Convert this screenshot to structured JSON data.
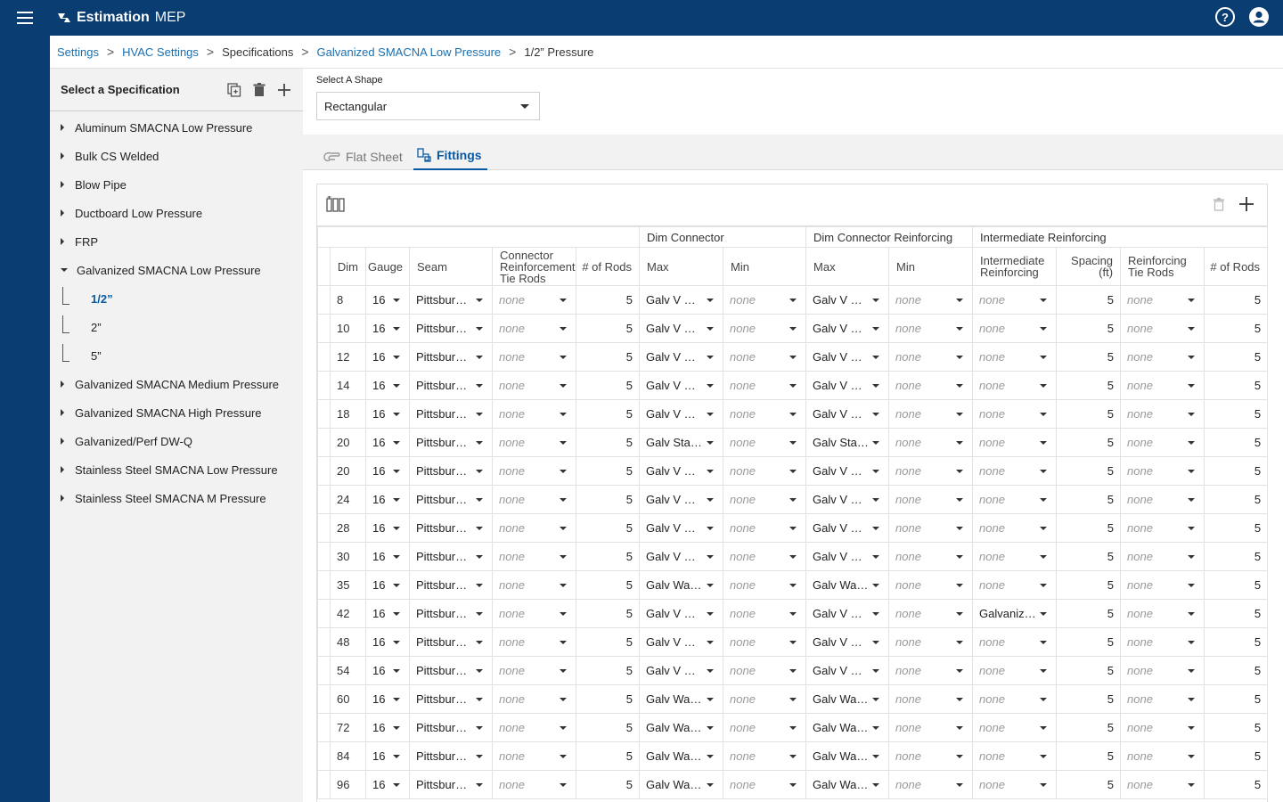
{
  "app": {
    "name": "Estimation",
    "name_suffix": "MEP"
  },
  "breadcrumb": [
    "Settings",
    "HVAC Settings",
    "Specifications",
    "Galvanized SMACNA Low Pressure",
    "1/2” Pressure"
  ],
  "left_panel": {
    "title": "Select a Specification",
    "items": [
      {
        "label": "Aluminum SMACNA Low Pressure"
      },
      {
        "label": "Bulk CS Welded"
      },
      {
        "label": "Blow Pipe"
      },
      {
        "label": "Ductboard Low Pressure"
      },
      {
        "label": "FRP"
      },
      {
        "label": "Galvanized SMACNA Low Pressure",
        "expanded": true,
        "children": [
          "1/2”",
          "2”",
          "5”"
        ]
      },
      {
        "label": "Galvanized SMACNA Medium Pressure"
      },
      {
        "label": "Galvanized SMACNA High Pressure"
      },
      {
        "label": "Galvanized/Perf DW-Q"
      },
      {
        "label": "Stainless Steel SMACNA Low Pressure"
      },
      {
        "label": "Stainless Steel SMACNA M Pressure"
      }
    ]
  },
  "shape": {
    "label": "Select A Shape",
    "value": "Rectangular"
  },
  "tabs": {
    "flat_sheet": "Flat Sheet",
    "fittings": "Fittings"
  },
  "table": {
    "groups": {
      "dim_connector": "Dim Connector",
      "dim_connector_reinforcing": "Dim Connector Reinforcing",
      "intermediate_reinforcing": "Intermediate Reinforcing"
    },
    "columns": {
      "dim": "Dim",
      "gauge": "Gauge",
      "seam": "Seam",
      "conn_tie_rods": "Connector Reinforcement Tie Rods",
      "rods": "# of Rods",
      "max": "Max",
      "min": "Min",
      "max2": "Max",
      "min2": "Min",
      "inter_reinf": "Intermediate Reinforcing",
      "spacing": "Spacing (ft)",
      "reinf_tie_rods": "Reinforcing Tie Rods",
      "rods2": "# of Rods"
    },
    "rows": [
      [
        "8",
        "16",
        "Pittsburgh Lock",
        "none",
        "5",
        "Galv V Slip",
        "none",
        "Galv V Slip",
        "none",
        "none",
        "5",
        "none",
        "5"
      ],
      [
        "10",
        "16",
        "Pittsburgh Lock",
        "none",
        "5",
        "Galv V Slip",
        "none",
        "Galv V Slip",
        "none",
        "none",
        "5",
        "none",
        "5"
      ],
      [
        "12",
        "16",
        "Pittsburgh Lock",
        "none",
        "5",
        "Galv V Slip",
        "none",
        "Galv V Slip",
        "none",
        "none",
        "5",
        "none",
        "5"
      ],
      [
        "14",
        "16",
        "Pittsburgh Lock",
        "none",
        "5",
        "Galv V Slip",
        "none",
        "Galv V Slip",
        "none",
        "none",
        "5",
        "none",
        "5"
      ],
      [
        "18",
        "16",
        "Pittsburgh Lock",
        "none",
        "5",
        "Galv V Slip",
        "none",
        "Galv V Slip",
        "none",
        "none",
        "5",
        "none",
        "5"
      ],
      [
        "20",
        "16",
        "Pittsburgh Lock",
        "none",
        "5",
        "Galv Standing S",
        "none",
        "Galv Standing S",
        "none",
        "none",
        "5",
        "none",
        "5"
      ],
      [
        "20",
        "16",
        "Pittsburgh Lock",
        "none",
        "5",
        "Galv V Slip",
        "none",
        "Galv V Slip",
        "none",
        "none",
        "5",
        "none",
        "5"
      ],
      [
        "24",
        "16",
        "Pittsburgh Lock",
        "none",
        "5",
        "Galv V Slip",
        "none",
        "Galv V Slip",
        "none",
        "none",
        "5",
        "none",
        "5"
      ],
      [
        "28",
        "16",
        "Pittsburgh Lock",
        "none",
        "5",
        "Galv V Slip",
        "none",
        "Galv V Slip",
        "none",
        "none",
        "5",
        "none",
        "5"
      ],
      [
        "30",
        "16",
        "Pittsburgh Lock",
        "none",
        "5",
        "Galv V Slip",
        "none",
        "Galv V Slip",
        "none",
        "none",
        "5",
        "none",
        "5"
      ],
      [
        "35",
        "16",
        "Pittsburgh Lock",
        "none",
        "5",
        "Galv Wardflex",
        "none",
        "Galv Wardflex",
        "none",
        "none",
        "5",
        "none",
        "5"
      ],
      [
        "42",
        "16",
        "Pittsburgh Lock",
        "none",
        "5",
        "Galv V Slip",
        "none",
        "Galv V Slip",
        "none",
        "Galvanized Angle",
        "5",
        "none",
        "5"
      ],
      [
        "48",
        "16",
        "Pittsburgh Lock",
        "none",
        "5",
        "Galv V Slip",
        "none",
        "Galv V Slip",
        "none",
        "none",
        "5",
        "none",
        "5"
      ],
      [
        "54",
        "16",
        "Pittsburgh Lock",
        "none",
        "5",
        "Galv V Slip",
        "none",
        "Galv V Slip",
        "none",
        "none",
        "5",
        "none",
        "5"
      ],
      [
        "60",
        "16",
        "Pittsburgh Lock",
        "none",
        "5",
        "Galv Wardflex",
        "none",
        "Galv Wardflex",
        "none",
        "none",
        "5",
        "none",
        "5"
      ],
      [
        "72",
        "16",
        "Pittsburgh Lock",
        "none",
        "5",
        "Galv Wardflex",
        "none",
        "Galv Wardflex",
        "none",
        "none",
        "5",
        "none",
        "5"
      ],
      [
        "84",
        "16",
        "Pittsburgh Lock",
        "none",
        "5",
        "Galv Wardflex",
        "none",
        "Galv Wardflex",
        "none",
        "none",
        "5",
        "none",
        "5"
      ],
      [
        "96",
        "16",
        "Pittsburgh Lock",
        "none",
        "5",
        "Galv Wardflex",
        "none",
        "Galv Wardflex",
        "none",
        "none",
        "5",
        "none",
        "5"
      ]
    ]
  },
  "colors": {
    "brand": "#0a3d72",
    "accent": "#0a5aa3",
    "link": "#1a6fb0"
  },
  "icons": [
    "menu-icon",
    "logo-icon",
    "help-icon",
    "account-icon",
    "copy-icon",
    "trash-icon",
    "add-icon",
    "flat-sheet-icon",
    "fittings-icon",
    "column-chooser-icon"
  ]
}
